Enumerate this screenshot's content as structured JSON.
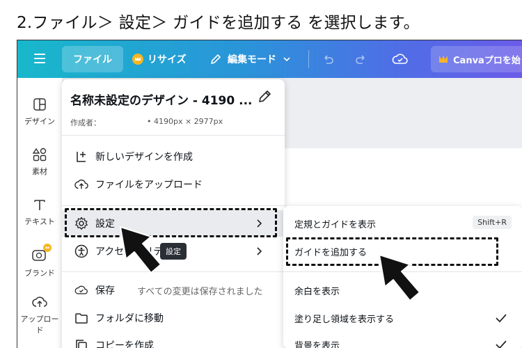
{
  "caption": "2.ファイル＞ 設定＞ ガイドを追加する を選択します。",
  "topbar": {
    "file_label": "ファイル",
    "resize_label": "リサイズ",
    "edit_mode_label": "編集モード",
    "canva_pro_label": "Canvaプロを始"
  },
  "sidebar": {
    "items": [
      {
        "label": "デザイン",
        "icon": "layout-icon"
      },
      {
        "label": "素材",
        "icon": "elements-icon"
      },
      {
        "label": "テキスト",
        "icon": "text-icon"
      },
      {
        "label": "ブランド",
        "icon": "brand-icon"
      },
      {
        "label": "アップロード",
        "icon": "upload-icon"
      }
    ]
  },
  "file_menu": {
    "title": "名称未設定のデザイン - 4190 ...",
    "author_label": "作成者：",
    "size_label": "• 4190px × 2977px",
    "items": {
      "new_design": "新しいデザインを作成",
      "upload_file": "ファイルをアップロード",
      "settings": "設定",
      "accessibility": "アクセシビリティ",
      "save": "保存",
      "save_hint": "すべての変更は保存されました",
      "move_folder": "フォルダに移動",
      "make_copy": "コピーを作成"
    },
    "tooltip": "設定"
  },
  "settings_submenu": {
    "items": [
      {
        "label": "定規とガイドを表示",
        "shortcut": "Shift+R"
      },
      {
        "label": "ガイドを追加する"
      },
      {
        "label": "余白を表示"
      },
      {
        "label": "塗り足し領域を表示する",
        "checked": true
      },
      {
        "label": "背景を表示",
        "checked": true
      }
    ]
  },
  "colors": {
    "topbar_start": "#18b8cc",
    "topbar_end": "#6a5be8",
    "highlight": "#e9ebee",
    "crown": "#f6b624"
  }
}
